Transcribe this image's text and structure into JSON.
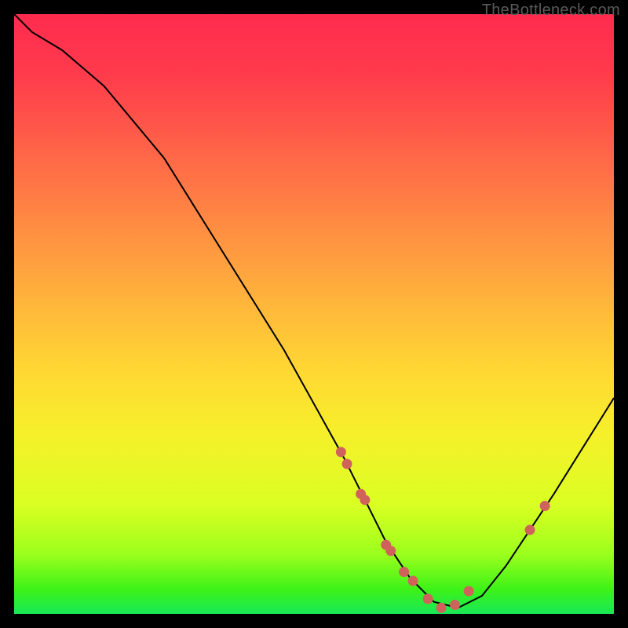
{
  "watermark": "TheBottleneck.com",
  "chart_data": {
    "type": "line",
    "title": "",
    "xlabel": "",
    "ylabel": "",
    "xlim": [
      0,
      100
    ],
    "ylim": [
      0,
      100
    ],
    "curve": {
      "x": [
        0,
        3,
        8,
        15,
        25,
        35,
        45,
        55,
        62,
        66,
        70,
        74,
        78,
        82,
        86,
        90,
        95,
        100
      ],
      "y": [
        100,
        97,
        94,
        88,
        76,
        60,
        44,
        26,
        12,
        6,
        2,
        1,
        3,
        8,
        14,
        20,
        28,
        36
      ]
    },
    "markers": {
      "x": [
        54.5,
        55.5,
        57.8,
        58.5,
        62.0,
        62.8,
        65.0,
        66.5,
        69.0,
        71.2,
        73.5,
        75.8,
        86.0,
        88.5
      ],
      "y": [
        27.0,
        25.0,
        20.0,
        19.0,
        11.5,
        10.5,
        7.0,
        5.5,
        2.5,
        1.0,
        1.5,
        3.8,
        14.0,
        18.0
      ]
    }
  }
}
